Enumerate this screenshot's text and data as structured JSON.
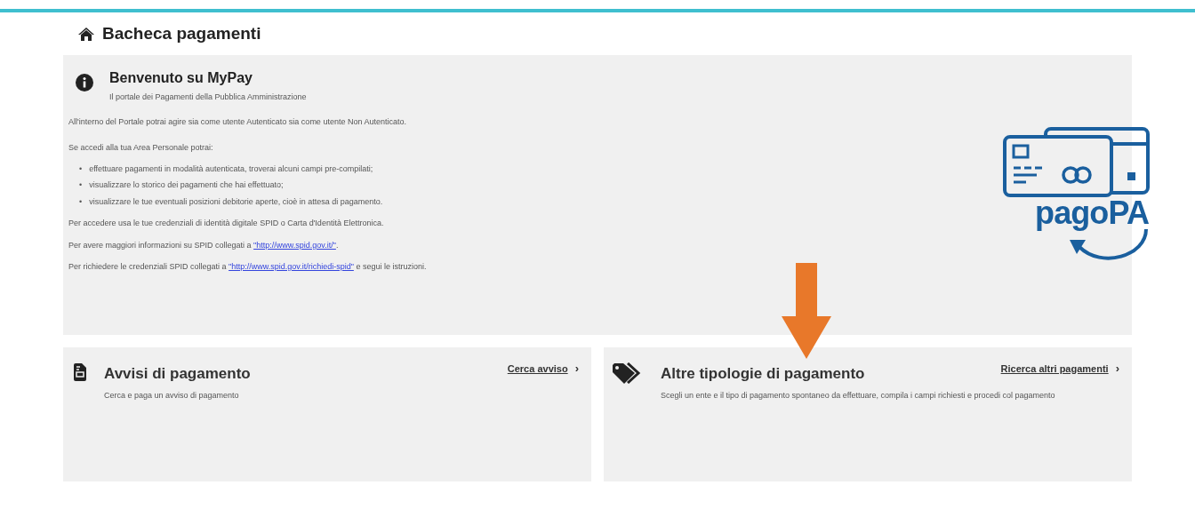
{
  "page_title": "Bacheca pagamenti",
  "welcome": {
    "title": "Benvenuto su MyPay",
    "subtitle": "Il portale dei Pagamenti della Pubblica Amministrazione",
    "intro": "All'interno del Portale potrai agire sia come utente Autenticato sia come utente Non Autenticato.",
    "list_heading": "Se accedi alla tua Area Personale potrai:",
    "bullets": [
      {
        "marker": "•",
        "text": "effettuare pagamenti in modalità autenticata, troverai alcuni campi pre-compilati;"
      },
      {
        "marker": "•",
        "text": "visualizzare lo storico dei pagamenti che hai effettuato;"
      },
      {
        "marker": "•",
        "text": "visualizzare le tue eventuali posizioni debitorie aperte, cioè in attesa di pagamento."
      }
    ],
    "access_note": "Per accedere usa le tue credenziali di identità digitale SPID o Carta d'Identità Elettronica.",
    "link_paragraphs": [
      {
        "before": "Per avere maggiori informazioni su SPID collegati a ",
        "link": "\"http://www.spid.gov.it/\"",
        "after": "."
      },
      {
        "before": "Per richiedere le credenziali SPID collegati a ",
        "link": "\"http://www.spid.gov.it/richiedi-spid\"",
        "after": " e segui le istruzioni."
      }
    ],
    "logo_text": "pagoPA"
  },
  "cards": [
    {
      "kind": "document",
      "title": "Avvisi di pagamento",
      "description": "Cerca e paga un avviso di pagamento",
      "link": "Cerca avviso",
      "chevron": "›"
    },
    {
      "kind": "tags",
      "title": "Altre tipologie di pagamento",
      "description": "Scegli un ente e il tipo di pagamento spontaneo da effettuare, compila i campi richiesti e procedi col pagamento",
      "link": "Ricerca altri pagamenti",
      "chevron": "›"
    }
  ]
}
